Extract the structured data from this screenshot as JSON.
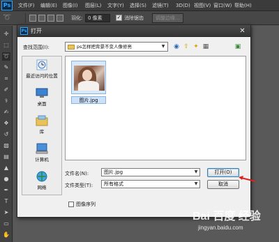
{
  "app": {
    "logo": "Ps",
    "menus": [
      "文件(F)",
      "编辑(E)",
      "图像(I)",
      "图层(L)",
      "文字(Y)",
      "选择(S)",
      "滤镜(T)",
      "3D(D)",
      "视图(V)",
      "窗口(W)",
      "帮助(H)"
    ]
  },
  "options": {
    "feather_label": "羽化:",
    "feather_value": "0 像素",
    "antialias_label": "消除锯齿",
    "antialias_checked": true,
    "refine_edge_label": "调整边缘..."
  },
  "dialog": {
    "title": "打开",
    "look_in_label": "查找范围(I):",
    "look_in_value": "ps怎样把背景不变人像修亮",
    "places": [
      {
        "label": "最近访问的位置",
        "icon": "recent-places-icon"
      },
      {
        "label": "桌面",
        "icon": "desktop-icon"
      },
      {
        "label": "库",
        "icon": "libraries-icon"
      },
      {
        "label": "计算机",
        "icon": "computer-icon"
      },
      {
        "label": "网络",
        "icon": "network-icon"
      }
    ],
    "files": [
      {
        "name": "图片.jpg",
        "selected": true
      }
    ],
    "filename_label": "文件名(N):",
    "filename_value": "图片.jpg",
    "filetype_label": "文件类型(T):",
    "filetype_value": "所有格式",
    "open_button": "打开(O)",
    "cancel_button": "取消",
    "image_sequence_label": "图像序列",
    "image_sequence_checked": false
  },
  "watermark": {
    "logo": "Bai 百度 经验",
    "url": "jingyan.baidu.com"
  }
}
